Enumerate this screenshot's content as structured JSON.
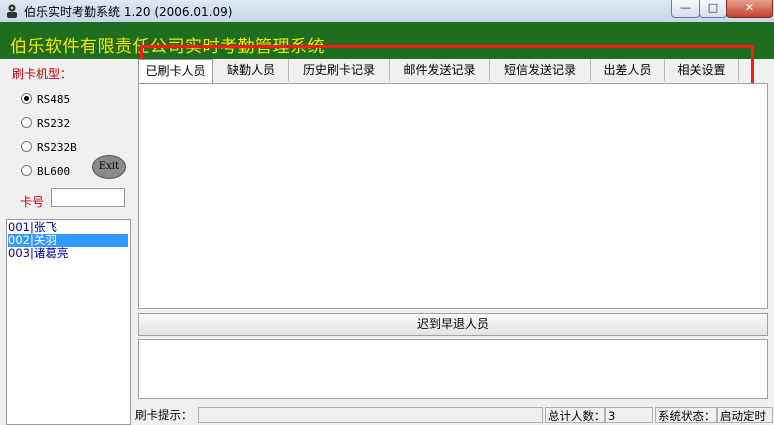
{
  "window": {
    "title": "伯乐实时考勤系统 1.20 (2006.01.09)",
    "minimize": "—",
    "maximize": "□",
    "close": "✕"
  },
  "banner": {
    "text": "伯乐软件有限责任公司实时考勤管理系统",
    "color": "#f7e600",
    "bg": "#1f6e1f"
  },
  "left": {
    "card_type_label": "刷卡机型：",
    "options": [
      "RS485",
      "RS232",
      "RS232B",
      "BL600"
    ],
    "selected_option": "RS485",
    "exit_label": "Exit",
    "card_no_label": "卡号",
    "card_no_value": ""
  },
  "users": [
    {
      "id": "001",
      "name": "张飞",
      "selected": false
    },
    {
      "id": "002",
      "name": "关羽",
      "selected": true
    },
    {
      "id": "003",
      "name": "诸葛亮",
      "selected": false
    }
  ],
  "tabs": [
    "已刷卡人员",
    "缺勤人员",
    "历史刷卡记录",
    "邮件发送记录",
    "短信发送记录",
    "出差人员",
    "相关设置"
  ],
  "active_tab": "已刷卡人员",
  "late_button": "迟到早退人员",
  "status": {
    "hint_label": "刷卡提示：",
    "hint_value": "",
    "total_label": "总计人数：",
    "total_value": "3",
    "state_label": "系统状态：",
    "state_value": "启动定时"
  },
  "highlight_color": "#ff1a1a"
}
